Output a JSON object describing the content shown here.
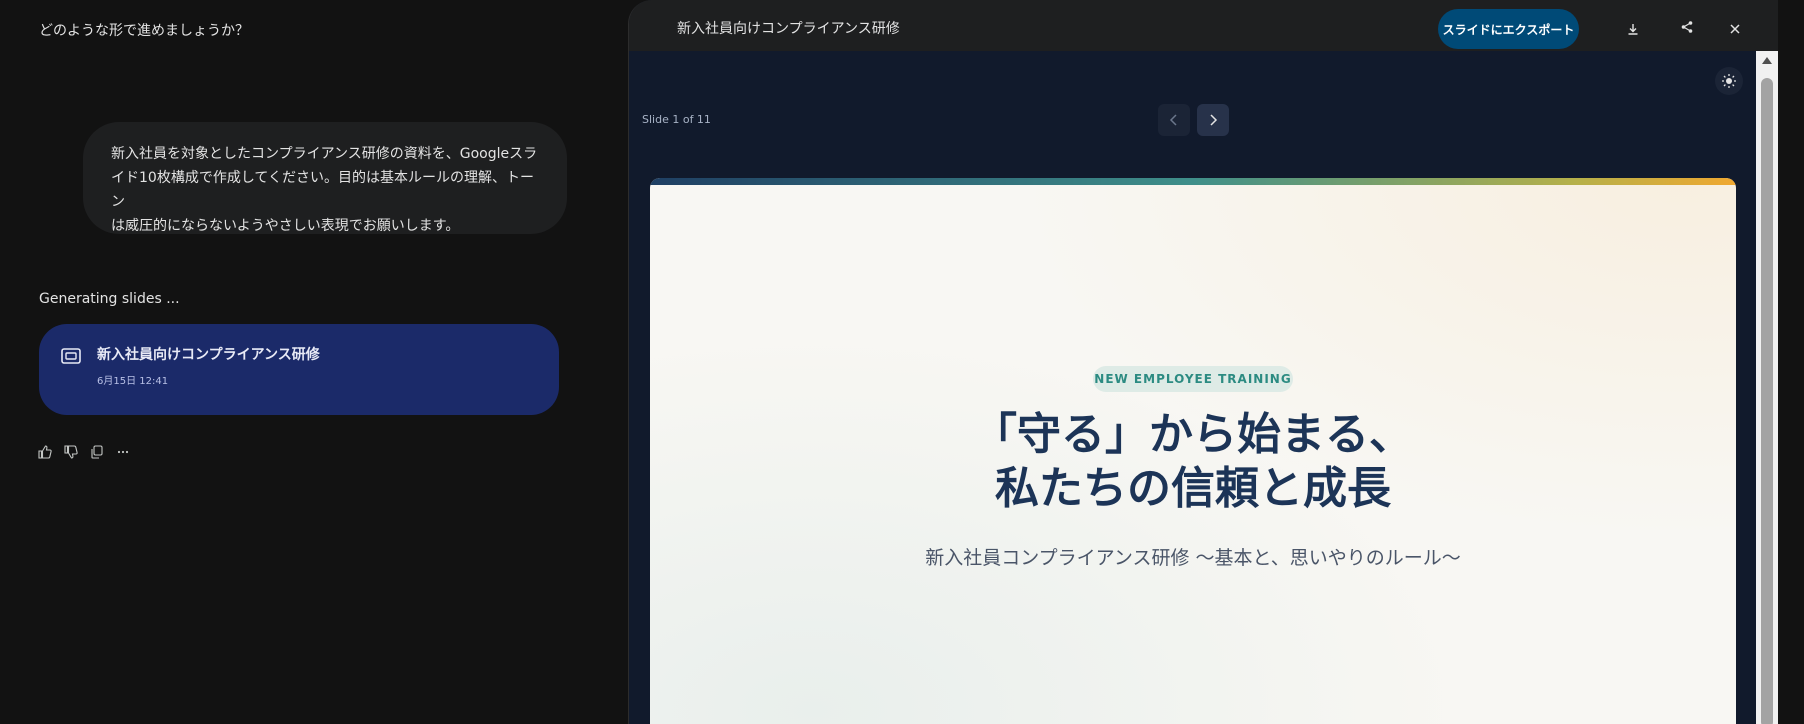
{
  "chat": {
    "prompt_question": "どのような形で進めましょうか？",
    "user_message_lines": [
      "新入社員を対象としたコンプライアンス研修の資料を、Googleスラ",
      "イド10枚構成で作成してください。目的は基本ルールの理解、トーン",
      "は威圧的にならないようやさしい表現でお願いします。"
    ],
    "status": "Generating slides ...",
    "card": {
      "title": "新入社員向けコンプライアンス研修",
      "date": "6月15日 12:41",
      "icon": "slides-icon"
    },
    "actions": [
      "thumbs-up-icon",
      "thumbs-down-icon",
      "copy-icon",
      "more-icon"
    ]
  },
  "panel": {
    "title": "新入社員向けコンプライアンス研修",
    "export_label": "スライドにエクスポート",
    "header_icons": [
      "download-icon",
      "share-icon",
      "close-icon"
    ],
    "slide_counter": "Slide 1 of 11",
    "theme_icon": "sun-icon"
  },
  "slide": {
    "tag": "NEW EMPLOYEE TRAINING",
    "headline_lines": [
      "「守る」から始まる、",
      "私たちの信頼と成長"
    ],
    "subheadline": "新入社員コンプライアンス研修 〜基本と、思いやりのルール〜"
  },
  "colors": {
    "chat_bg": "#121212",
    "panel_bg": "#111a2c",
    "card_bg": "#1b2a69",
    "export_bg": "#004a77",
    "headline": "#1c3457",
    "tag_text": "#2c8b82"
  }
}
